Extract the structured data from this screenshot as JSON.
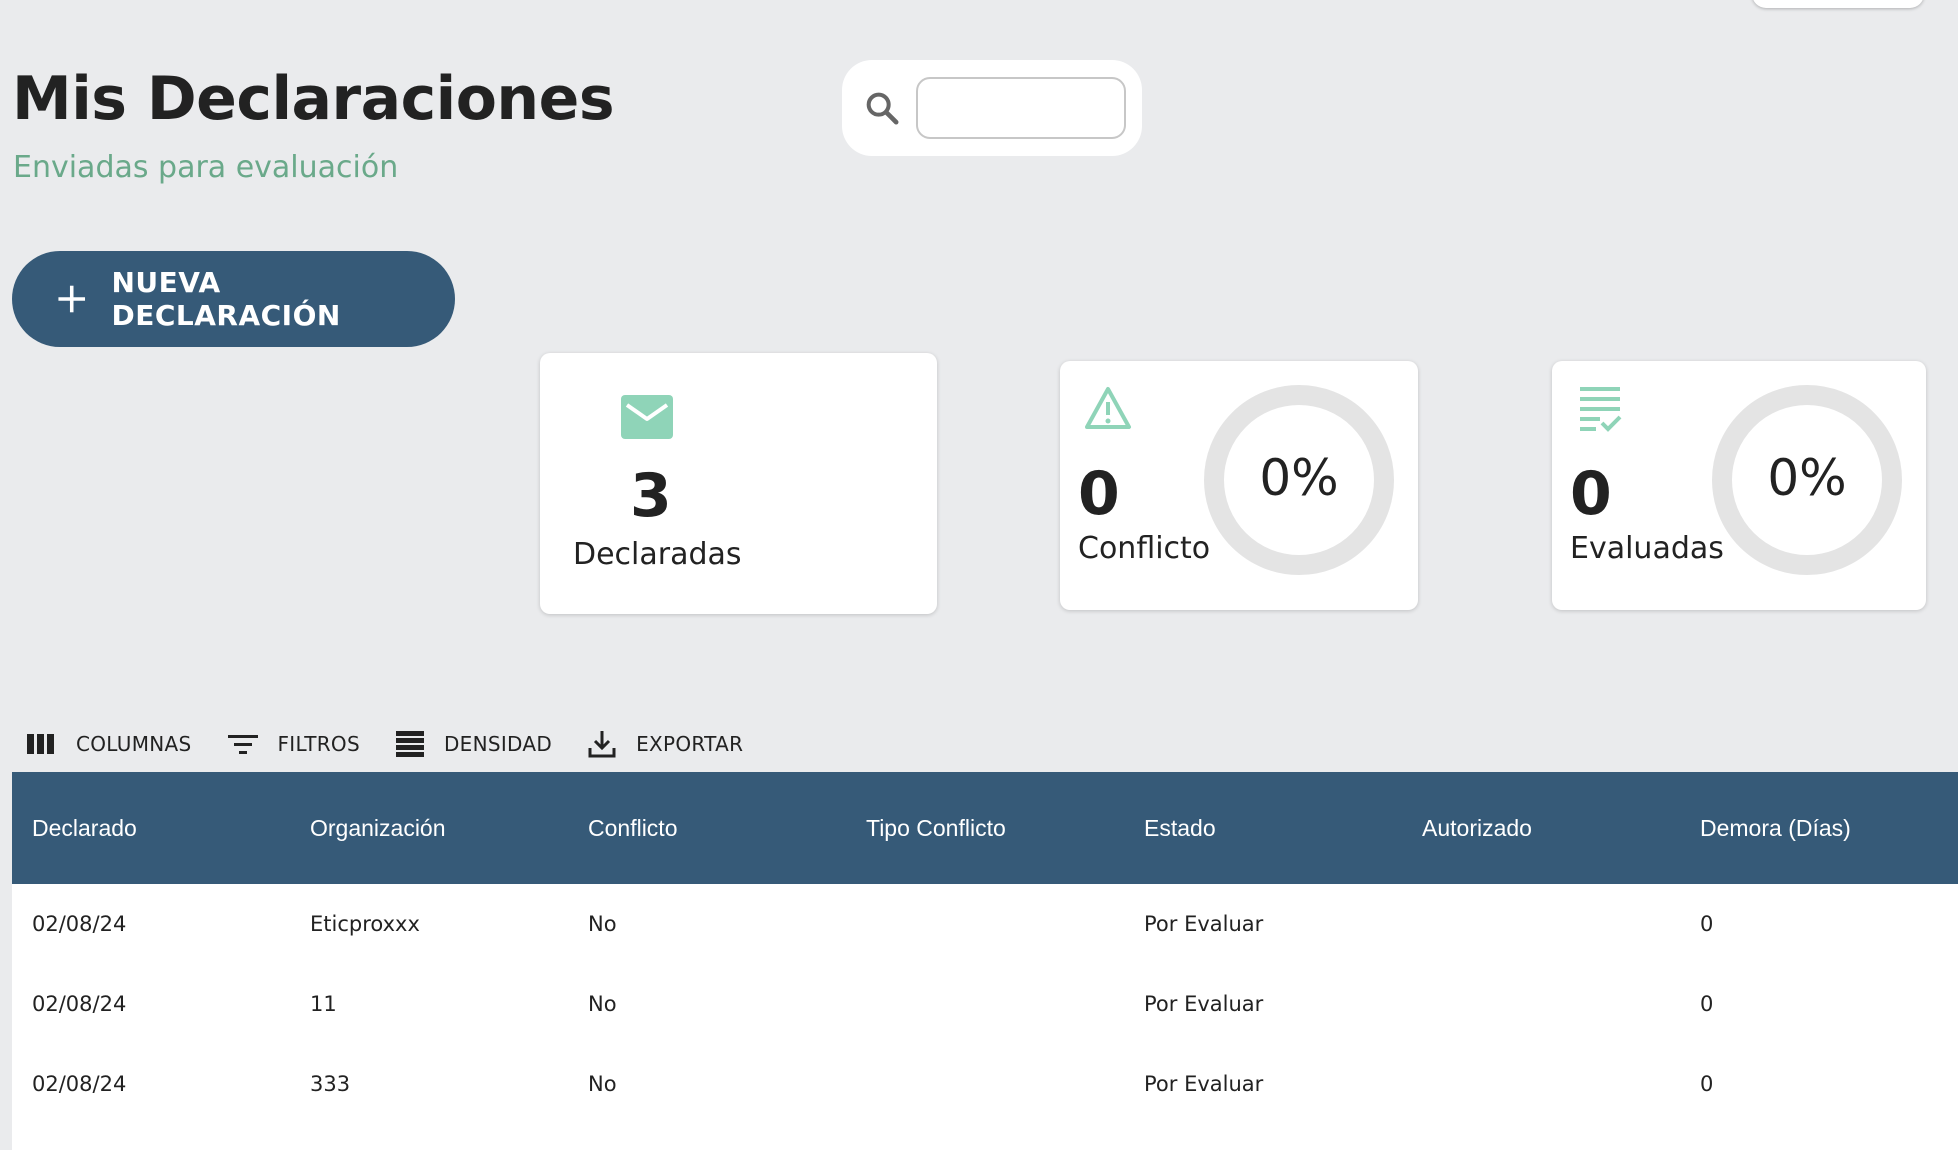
{
  "header": {
    "title": "Mis Declaraciones",
    "subtitle": "Enviadas para evaluación"
  },
  "search": {
    "value": "",
    "icon": "search-icon"
  },
  "actions": {
    "new_label": "NUEVA DECLARACIÓN",
    "icon": "plus-icon"
  },
  "stats": {
    "declared": {
      "value": "3",
      "label": "Declaradas",
      "icon": "mail-icon"
    },
    "conflict": {
      "value": "0",
      "label": "Conflicto",
      "percent": "0%",
      "icon": "warning-icon"
    },
    "evaluated": {
      "value": "0",
      "label": "Evaluadas",
      "percent": "0%",
      "icon": "checklist-icon"
    }
  },
  "toolbar": {
    "columns": "COLUMNAS",
    "filters": "FILTROS",
    "density": "DENSIDAD",
    "export": "EXPORTAR"
  },
  "table": {
    "columns": [
      "Declarado",
      "Organización",
      "Conflicto",
      "Tipo Conflicto",
      "Estado",
      "Autorizado",
      "Demora (Días)"
    ],
    "rows": [
      [
        "02/08/24",
        "Eticproxxx",
        "No",
        "",
        "Por Evaluar",
        "",
        "0"
      ],
      [
        "02/08/24",
        "11",
        "No",
        "",
        "Por Evaluar",
        "",
        "0"
      ],
      [
        "02/08/24",
        "333",
        "No",
        "",
        "Por Evaluar",
        "",
        "0"
      ]
    ]
  },
  "colors": {
    "primary": "#365a78",
    "accent": "#8fd4b8",
    "subtitle": "#6aa98a",
    "background": "#eaebed"
  }
}
